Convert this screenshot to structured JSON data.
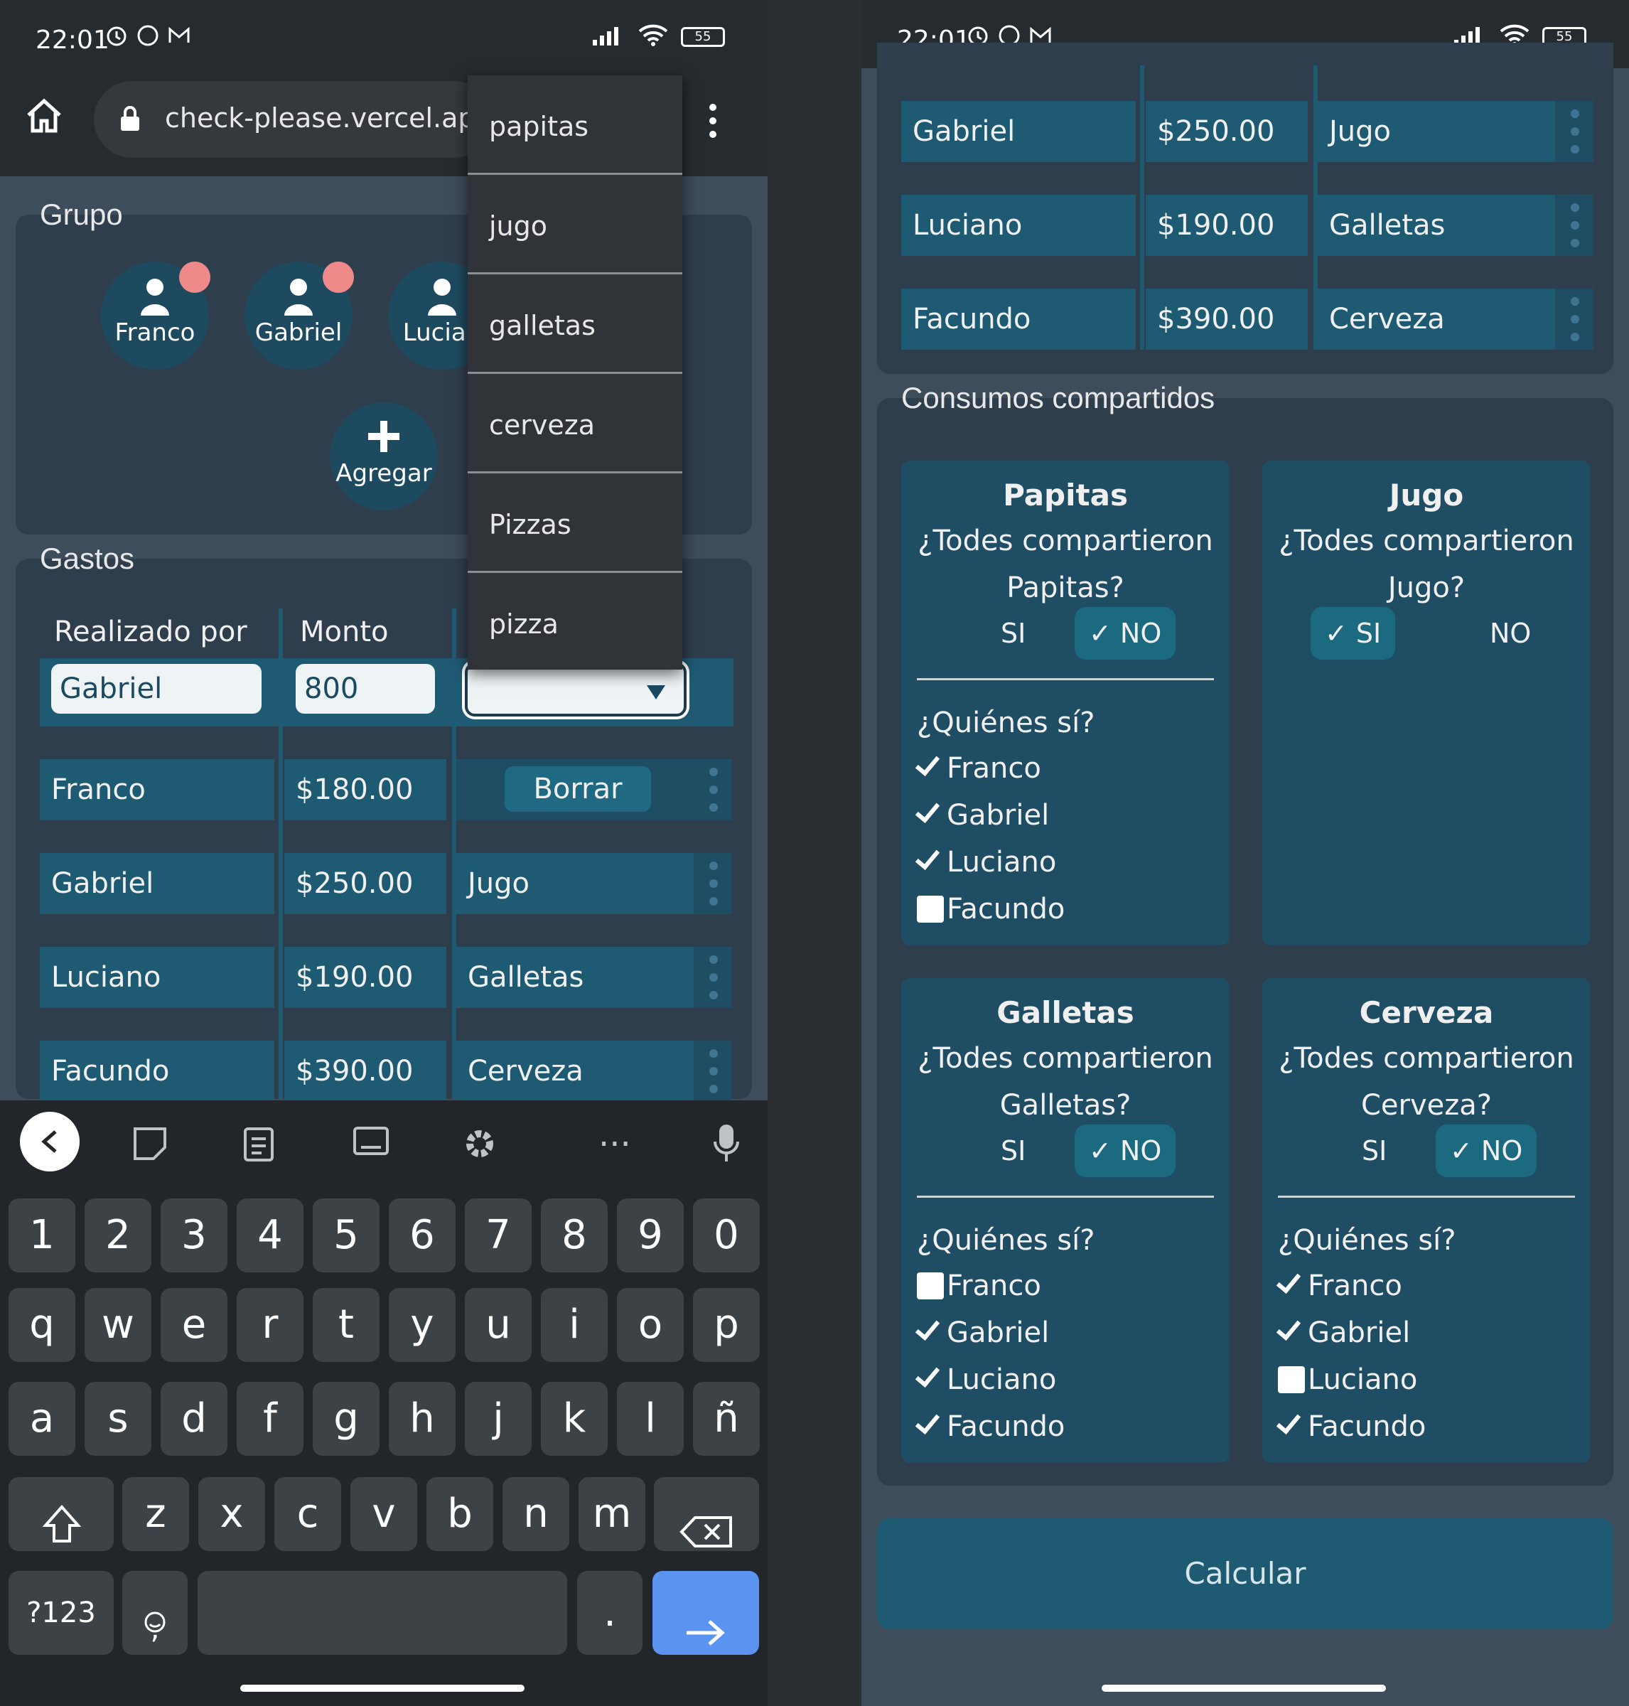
{
  "status": {
    "time": "22:01",
    "battery": "55"
  },
  "browser": {
    "url": "check-please.vercel.app"
  },
  "dropdown": {
    "options": [
      "papitas",
      "jugo",
      "galletas",
      "cerveza",
      "Pizzas",
      "pizza"
    ]
  },
  "grupo": {
    "title": "Grupo",
    "members": [
      "Franco",
      "Gabriel",
      "Lucian"
    ],
    "add_label": "Agregar"
  },
  "gastos": {
    "title": "Gastos",
    "headers": [
      "Realizado por",
      "Monto"
    ],
    "input_name": "Gabriel",
    "input_amount": "800",
    "delete_label": "Borrar",
    "rows": [
      {
        "name": "Franco",
        "amount": "$180.00",
        "item": ""
      },
      {
        "name": "Gabriel",
        "amount": "$250.00",
        "item": "Jugo"
      },
      {
        "name": "Luciano",
        "amount": "$190.00",
        "item": "Galletas"
      },
      {
        "name": "Facundo",
        "amount": "$390.00",
        "item": "Cerveza"
      }
    ]
  },
  "keyboard": {
    "row1": [
      "1",
      "2",
      "3",
      "4",
      "5",
      "6",
      "7",
      "8",
      "9",
      "0"
    ],
    "row2": [
      "q",
      "w",
      "e",
      "r",
      "t",
      "y",
      "u",
      "i",
      "o",
      "p"
    ],
    "row3": [
      "a",
      "s",
      "d",
      "f",
      "g",
      "h",
      "j",
      "k",
      "l",
      "ñ"
    ],
    "row4": [
      "z",
      "x",
      "c",
      "v",
      "b",
      "n",
      "m"
    ],
    "sym_label": "?123",
    "comma_label": ",",
    "period_label": ".",
    "more_label": "···"
  },
  "right": {
    "rows": [
      {
        "name": "Gabriel",
        "amount": "$250.00",
        "item": "Jugo"
      },
      {
        "name": "Luciano",
        "amount": "$190.00",
        "item": "Galletas"
      },
      {
        "name": "Facundo",
        "amount": "$390.00",
        "item": "Cerveza"
      }
    ],
    "shared_title": "Consumos compartidos",
    "question_prefix": "¿Todes compartieron",
    "who_label": "¿Quiénes sí?",
    "si_label": "SI",
    "no_label": "NO",
    "items": [
      {
        "name": "Papitas",
        "q_item": "Papitas?",
        "answer": "NO",
        "people": [
          [
            "Franco",
            true
          ],
          [
            "Gabriel",
            true
          ],
          [
            "Luciano",
            true
          ],
          [
            "Facundo",
            false
          ]
        ]
      },
      {
        "name": "Jugo",
        "q_item": "Jugo?",
        "answer": "SI",
        "people": []
      },
      {
        "name": "Galletas",
        "q_item": "Galletas?",
        "answer": "NO",
        "people": [
          [
            "Franco",
            false
          ],
          [
            "Gabriel",
            true
          ],
          [
            "Luciano",
            true
          ],
          [
            "Facundo",
            true
          ]
        ]
      },
      {
        "name": "Cerveza",
        "q_item": "Cerveza?",
        "answer": "NO",
        "people": [
          [
            "Franco",
            true
          ],
          [
            "Gabriel",
            true
          ],
          [
            "Luciano",
            false
          ],
          [
            "Facundo",
            true
          ]
        ]
      }
    ],
    "calc_label": "Calcular"
  }
}
